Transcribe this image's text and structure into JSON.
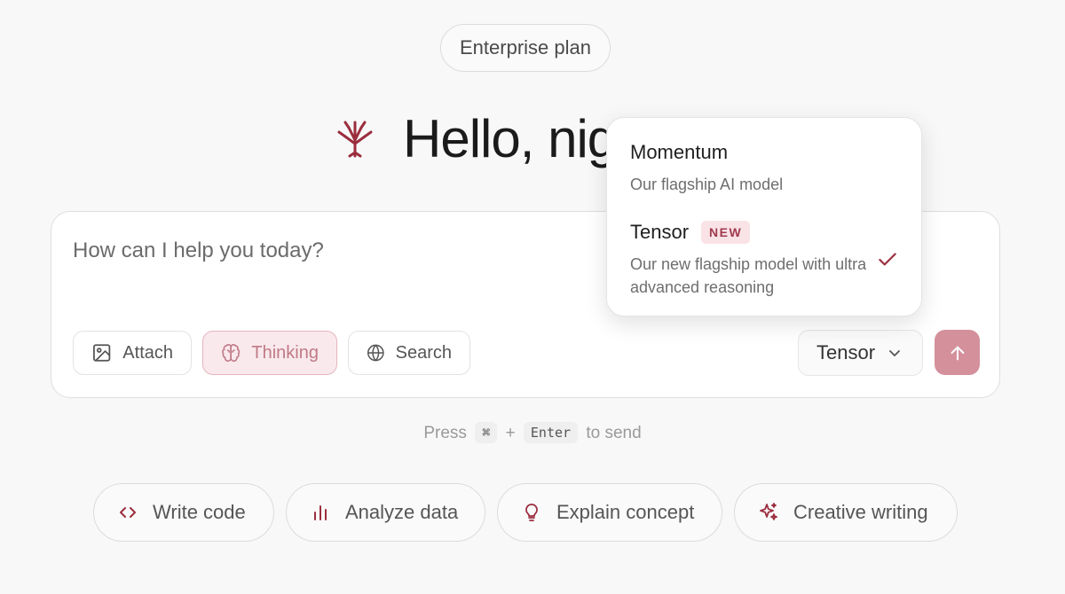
{
  "header": {
    "plan_label": "Enterprise plan",
    "greeting": "Hello, nigh"
  },
  "composer": {
    "placeholder": "How can I help you today?",
    "tools": {
      "attach": "Attach",
      "thinking": "Thinking",
      "search": "Search"
    },
    "model_selected": "Tensor"
  },
  "hint": {
    "press": "Press",
    "cmd_key": "⌘",
    "plus": "+",
    "enter_key": "Enter",
    "suffix": "to send"
  },
  "suggestions": {
    "write_code": "Write code",
    "analyze_data": "Analyze data",
    "explain_concept": "Explain concept",
    "creative_writing": "Creative writing"
  },
  "model_dropdown": {
    "options": [
      {
        "name": "Momentum",
        "description": "Our flagship AI model",
        "selected": false
      },
      {
        "name": "Tensor",
        "badge": "NEW",
        "description": "Our new flagship model with ultra advanced reasoning",
        "selected": true
      }
    ]
  },
  "colors": {
    "accent": "#9b2d3e",
    "send_button": "#d4909b",
    "thinking_bg": "#f9e9ec",
    "badge_bg": "#f9e3e7"
  },
  "icons": [
    "tree-logo-icon",
    "image-icon",
    "brain-icon",
    "globe-icon",
    "chevron-down-icon",
    "arrow-up-icon",
    "code-icon",
    "bar-chart-icon",
    "lightbulb-icon",
    "sparkles-icon",
    "checkmark-icon"
  ]
}
